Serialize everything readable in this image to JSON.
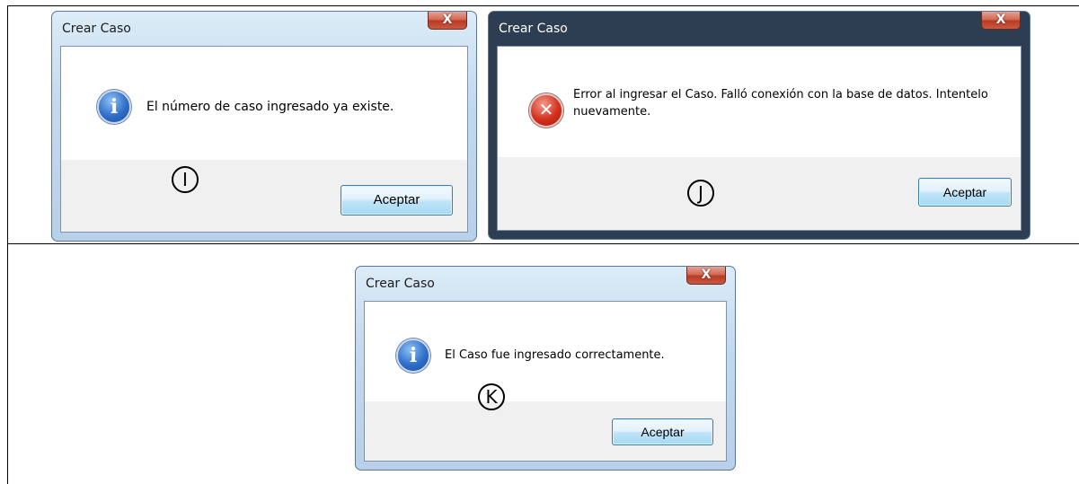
{
  "dialogs": [
    {
      "title": "Crear Caso",
      "close_glyph": "X",
      "icon": "info-icon",
      "message": "El número de caso ingresado ya existe.",
      "button_label": "Aceptar",
      "marker": "I"
    },
    {
      "title": "Crear Caso",
      "close_glyph": "X",
      "icon": "error-icon",
      "message": "Error al ingresar el Caso. Falló conexión con la base de datos. Intentelo nuevamente.",
      "button_label": "Aceptar",
      "marker": "J"
    },
    {
      "title": "Crear Caso",
      "close_glyph": "X",
      "icon": "info-icon",
      "message": "El Caso fue ingresado correctamente.",
      "button_label": "Aceptar",
      "marker": "K"
    }
  ],
  "colors": {
    "info_icon": "#2f6fc9",
    "error_icon": "#d4301c",
    "button_border": "#3c7fb1",
    "close_button": "#c85a44"
  }
}
